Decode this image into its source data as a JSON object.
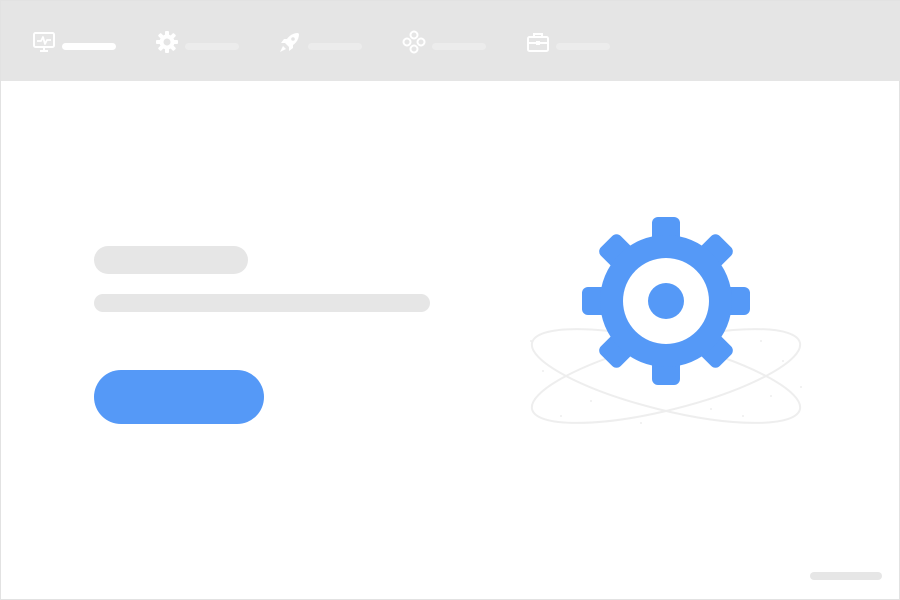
{
  "colors": {
    "topbar_bg": "#e5e5e5",
    "tab_icon": "#ffffff",
    "tab_label_bar": "#ececec",
    "placeholder_gray": "#e6e6e6",
    "accent_blue": "#5599f7",
    "background": "#ffffff"
  },
  "topbar": {
    "tabs": [
      {
        "icon": "monitor-activity-icon"
      },
      {
        "icon": "gear-icon"
      },
      {
        "icon": "rocket-icon"
      },
      {
        "icon": "nodes-icon"
      },
      {
        "icon": "briefcase-icon"
      }
    ]
  },
  "main": {
    "headline_placeholder": "",
    "subline_placeholder": "",
    "cta_label": ""
  },
  "illustration": {
    "icon": "gear-icon",
    "decoration": "orbit-rings"
  },
  "footer": {
    "placeholder": ""
  }
}
